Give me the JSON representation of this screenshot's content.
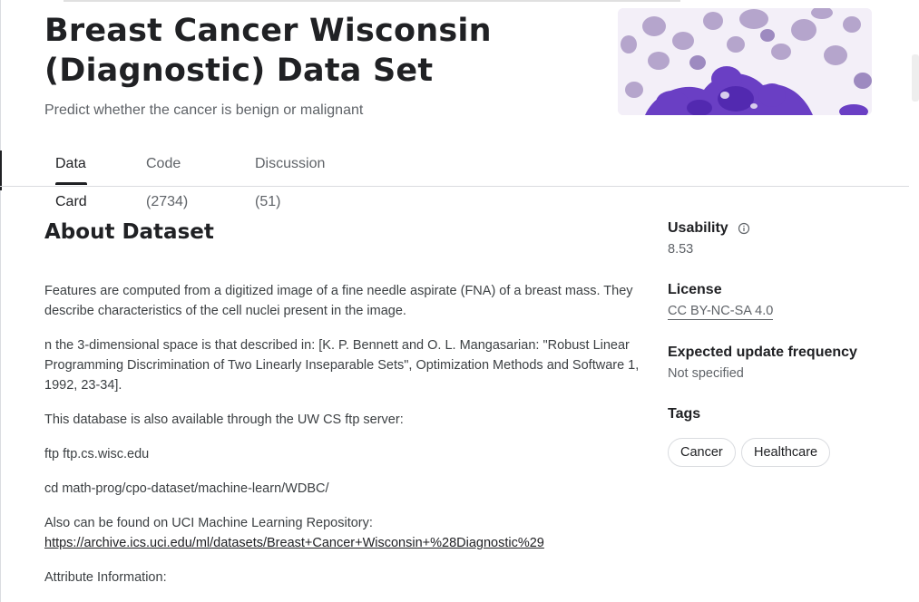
{
  "header": {
    "title": "Breast Cancer Wisconsin (Diagnostic) Data Set",
    "subtitle": "Predict whether the cancer is benign or malignant"
  },
  "tabs": [
    {
      "label": "Data Card",
      "active": true
    },
    {
      "label": "Code (2734)",
      "active": false
    },
    {
      "label": "Discussion (51)",
      "active": false
    }
  ],
  "about": {
    "heading": "About Dataset",
    "p1": "Features are computed from a digitized image of a fine needle aspirate (FNA) of a breast mass. They describe characteristics of the cell nuclei present in the image.",
    "p2": "n the 3-dimensional space is that described in: [K. P. Bennett and O. L. Mangasarian: \"Robust Linear Programming Discrimination of Two Linearly Inseparable Sets\", Optimization Methods and Software 1, 1992, 23-34].",
    "p3": "This database is also available through the UW CS ftp server:",
    "p4": "ftp ftp.cs.wisc.edu",
    "p5": "cd math-prog/cpo-dataset/machine-learn/WDBC/",
    "p6": "Also can be found on UCI Machine Learning Repository:",
    "link": "https://archive.ics.uci.edu/ml/datasets/Breast+Cancer+Wisconsin+%28Diagnostic%29",
    "p7": "Attribute Information:"
  },
  "sidebar": {
    "usability_label": "Usability",
    "usability_value": "8.53",
    "license_label": "License",
    "license_value": "CC BY-NC-SA 4.0",
    "update_label": "Expected update frequency",
    "update_value": "Not specified",
    "tags_label": "Tags",
    "tags": [
      "Cancer",
      "Healthcare"
    ]
  },
  "icons": {
    "usability_info": "info-circle-icon"
  },
  "colors": {
    "text": "#202124",
    "muted": "#5f6368",
    "border": "#dadce0",
    "cell_purple": "#6a3fc4"
  }
}
